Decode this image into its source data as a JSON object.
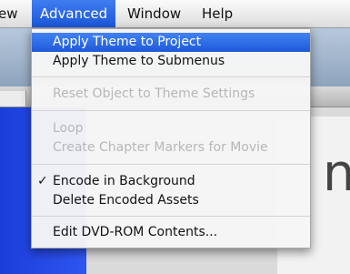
{
  "menubar": {
    "items": [
      {
        "label": "ew"
      },
      {
        "label": "Advanced"
      },
      {
        "label": "Window"
      },
      {
        "label": "Help"
      }
    ]
  },
  "menu": {
    "items": [
      {
        "label": "Apply Theme to Project"
      },
      {
        "label": "Apply Theme to Submenus"
      },
      {
        "label": "Reset Object to Theme Settings"
      },
      {
        "label": "Loop"
      },
      {
        "label": "Create Chapter Markers for Movie"
      },
      {
        "label": "Encode in Background",
        "check": "✓"
      },
      {
        "label": "Delete Encoded Assets"
      },
      {
        "label": "Edit DVD-ROM Contents..."
      }
    ]
  },
  "background": {
    "letter": "n"
  }
}
